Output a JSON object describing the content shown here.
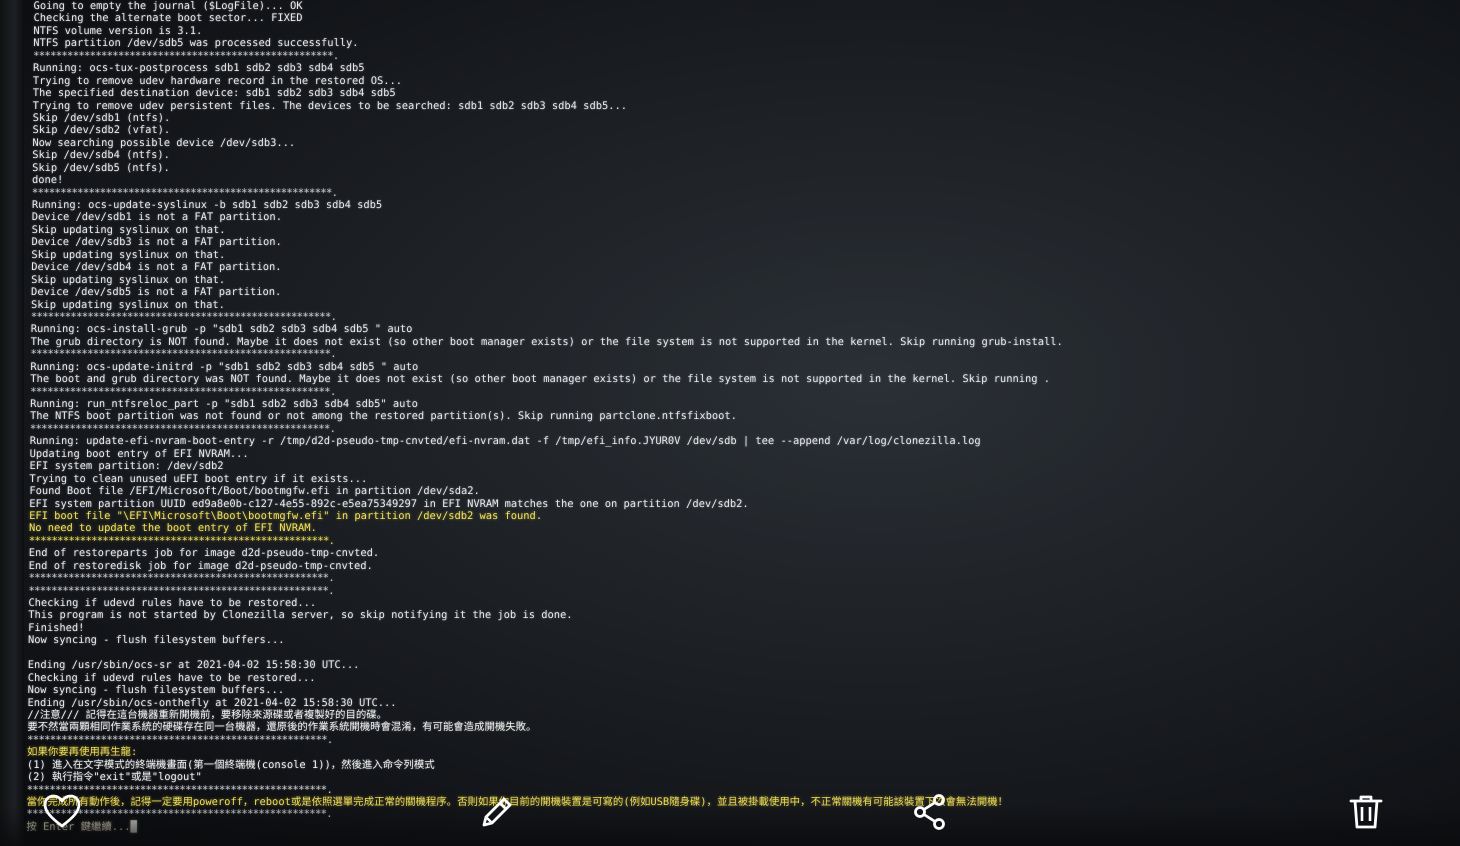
{
  "terminal": {
    "lines": [
      "Going to empty the journal ($LogFile)... OK",
      "Checking the alternate boot sector... FIXED",
      "NTFS volume version is 3.1.",
      "NTFS partition /dev/sdb5 was processed successfully.",
      "*****************************************************.",
      "Running: ocs-tux-postprocess sdb1 sdb2 sdb3 sdb4 sdb5",
      "Trying to remove udev hardware record in the restored OS...",
      "The specified destination device: sdb1 sdb2 sdb3 sdb4 sdb5",
      "Trying to remove udev persistent files. The devices to be searched: sdb1 sdb2 sdb3 sdb4 sdb5...",
      "Skip /dev/sdb1 (ntfs).",
      "Skip /dev/sdb2 (vfat).",
      "Now searching possible device /dev/sdb3...",
      "Skip /dev/sdb4 (ntfs).",
      "Skip /dev/sdb5 (ntfs).",
      "done!",
      "*****************************************************.",
      "Running: ocs-update-syslinux -b sdb1 sdb2 sdb3 sdb4 sdb5",
      "Device /dev/sdb1 is not a FAT partition.",
      "Skip updating syslinux on that.",
      "Device /dev/sdb3 is not a FAT partition.",
      "Skip updating syslinux on that.",
      "Device /dev/sdb4 is not a FAT partition.",
      "Skip updating syslinux on that.",
      "Device /dev/sdb5 is not a FAT partition.",
      "Skip updating syslinux on that.",
      "*****************************************************.",
      "Running: ocs-install-grub -p \"sdb1 sdb2 sdb3 sdb4 sdb5 \" auto",
      "The grub directory is NOT found. Maybe it does not exist (so other boot manager exists) or the file system is not supported in the kernel. Skip running grub-install.",
      "*****************************************************.",
      "Running: ocs-update-initrd -p \"sdb1 sdb2 sdb3 sdb4 sdb5 \" auto",
      "The boot and grub directory was NOT found. Maybe it does not exist (so other boot manager exists) or the file system is not supported in the kernel. Skip running .",
      "*****************************************************.",
      "Running: run_ntfsreloc_part -p \"sdb1 sdb2 sdb3 sdb4 sdb5\" auto",
      "The NTFS boot partition was not found or not among the restored partition(s). Skip running partclone.ntfsfixboot.",
      "*****************************************************.",
      "Running: update-efi-nvram-boot-entry -r /tmp/d2d-pseudo-tmp-cnvted/efi-nvram.dat -f /tmp/efi_info.JYUR0V /dev/sdb | tee --append /var/log/clonezilla.log",
      "Updating boot entry of EFI NVRAM...",
      "EFI system partition: /dev/sdb2",
      "Trying to clean unused uEFI boot entry if it exists...",
      "Found Boot file /EFI/Microsoft/Boot/bootmgfw.efi in partition /dev/sda2.",
      "EFI system partition UUID ed9a8e0b-c127-4e55-892c-e5ea75349297 in EFI NVRAM matches the one on partition /dev/sdb2.",
      "EFI boot file \"\\EFI\\Microsoft\\Boot\\bootmgfw.efi\" in partition /dev/sdb2 was found.",
      "No need to update the boot entry of EFI NVRAM.",
      "*****************************************************.",
      "End of restoreparts job for image d2d-pseudo-tmp-cnvted.",
      "End of restoredisk job for image d2d-pseudo-tmp-cnvted.",
      "*****************************************************.",
      "*****************************************************.",
      "Checking if udevd rules have to be restored...",
      "This program is not started by Clonezilla server, so skip notifying it the job is done.",
      "Finished!",
      "Now syncing - flush filesystem buffers...",
      "",
      "Ending /usr/sbin/ocs-sr at 2021-04-02 15:58:30 UTC...",
      "Checking if udevd rules have to be restored...",
      "Now syncing - flush filesystem buffers...",
      "Ending /usr/sbin/ocs-onthefly at 2021-04-02 15:58:30 UTC...",
      "//注意/// 記得在這台機器重新開機前，要移除來源碟或者複製好的目的碟。",
      "要不然當兩顆相同作業系統的硬碟存在同一台機器，還原後的作業系統開機時會混淆，有可能會造成開機失敗。",
      "*****************************************************.",
      "如果你要再使用再生龍:",
      "(1) 進入在文字模式的終端機畫面(第一個終端機(console 1))，然後進入命令列模式",
      "(2) 執行指令\"exit\"或是\"logout\"",
      "*****************************************************.",
      "當你完成所有動作後，記得一定要用poweroff，reboot或是依照選單完成正常的關機程序。否則如果你目前的開機裝置是可寫的(例如USB隨身碟)，並且被掛載使用中，不正常關機有可能該裝置下次會無法開機！",
      "*****************************************************.",
      "按 Enter 鍵繼續...█"
    ],
    "highlighted_lines": [
      41,
      42,
      43
    ]
  },
  "toolbar": {
    "like_icon": "heart-icon",
    "edit_icon": "pencil-icon",
    "share_icon": "share-icon",
    "delete_icon": "trash-icon"
  },
  "colors": {
    "text": "#e8eaec",
    "highlight": "#f2e25c",
    "icon": "#ffffff"
  }
}
